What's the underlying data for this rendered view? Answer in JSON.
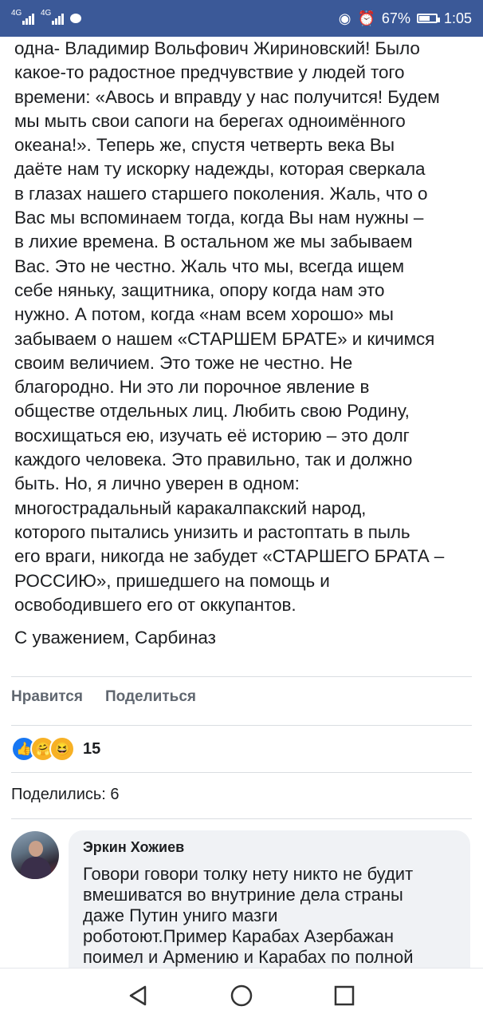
{
  "status_bar": {
    "network_1": "4G",
    "network_2": "4G",
    "battery_percent": "67%",
    "battery_level": 0.67,
    "time": "1:05"
  },
  "post": {
    "text": "одна- Владимир Вольфович Жириновский! Было\nкакое-то радостное предчувствие у людей того\nвремени: «Авось и вправду у нас получится! Будем\nмы мыть свои сапоги на берегах одноимённого\nокеана!». Теперь же, спустя четверть века Вы\nдаёте нам ту искорку надежды, которая сверкала\nв глазах нашего старшего поколения. Жаль, что о\nВас мы вспоминаем тогда, когда Вы нам нужны –\nв лихие времена. В остальном же мы забываем\nВас. Это не честно. Жаль что мы, всегда ищем\nсебе няньку, защитника, опору когда нам это\nнужно. А потом, когда «нам всем хорошо» мы\nзабываем о нашем «СТАРШЕМ БРАТЕ» и кичимся\nсвоим величием. Это тоже не честно. Не\nблагородно. Ни это ли порочное явление в\nобществе отдельных лиц. Любить свою Родину,\nвосхищаться ею, изучать её историю – это долг\nкаждого человека. Это правильно, так и должно\nбыть. Но, я лично уверен в одном:\nмногострадальный каракалпакский народ,\nкоторого пытались унизить и растоптать в пыль\nего враги, никогда не забудет «СТАРШЕГО БРАТА –\nРОССИЮ», пришедшего на помощь и\nосвободившего его от оккупантов.",
    "signature": "С уважением, Сарбиназ"
  },
  "actions": {
    "like_label": "Нравится",
    "share_label": "Поделиться"
  },
  "reactions": {
    "count": "15",
    "colors": {
      "like": "#1877f2",
      "care": "#f7b125",
      "haha": "#f7b125"
    }
  },
  "shares": {
    "label": "Поделились: 6"
  },
  "comment": {
    "author": "Эркин Хожиев",
    "text": "Говори говори толку нету никто не будит\nвмешиватся во внутриние дела страны\nдаже Путин униго мазги\nроботоют.Пример Карабах Азербажан\nпоимел и Армению и Карабах по полной"
  },
  "colors": {
    "status_bar_bg": "#3b5998",
    "bubble_bg": "#f0f2f5",
    "action_text": "#606770"
  }
}
